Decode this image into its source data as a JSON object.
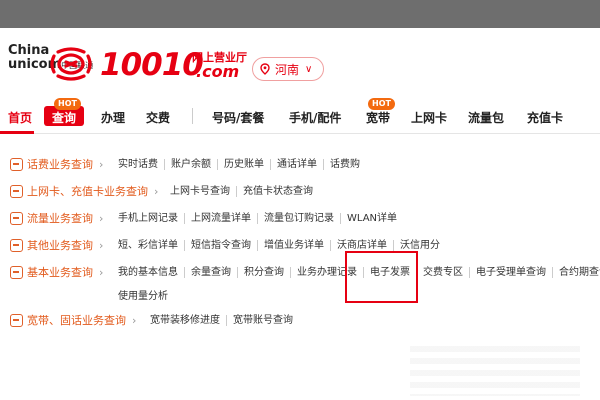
{
  "brand": {
    "company_line1": "China",
    "company_line2": "unicom",
    "company_cn": "中国联通",
    "number": "10010",
    "hall": "网上营业厅",
    "com": ".com",
    "province": "河南",
    "accent": "#e60012"
  },
  "nav": {
    "items": [
      {
        "label": "首页"
      },
      {
        "label": "查询",
        "badge": "HOT"
      },
      {
        "label": "办理"
      },
      {
        "label": "交费"
      },
      {
        "label": "号码/套餐"
      },
      {
        "label": "手机/配件"
      },
      {
        "label": "宽带",
        "badge": "HOT"
      },
      {
        "label": "上网卡"
      },
      {
        "label": "流量包"
      },
      {
        "label": "充值卡"
      }
    ]
  },
  "menu": {
    "rows": [
      {
        "category": "话费业务查询",
        "links": [
          "实时话费",
          "账户余额",
          "历史账单",
          "通话详单",
          "话费购"
        ]
      },
      {
        "category": "上网卡、充值卡业务查询",
        "links": [
          "上网卡号查询",
          "充值卡状态查询"
        ]
      },
      {
        "category": "流量业务查询",
        "links": [
          "手机上网记录",
          "上网流量详单",
          "流量包订购记录",
          "WLAN详单"
        ]
      },
      {
        "category": "其他业务查询",
        "links": [
          "短、彩信详单",
          "短信指令查询",
          "增值业务详单",
          "沃商店详单",
          "沃信用分"
        ]
      },
      {
        "category": "基本业务查询",
        "links": [
          "我的基本信息",
          "余量查询",
          "积分查询",
          "业务办理记录",
          "电子发票",
          "交费专区",
          "电子受理单查询",
          "合约期查询"
        ],
        "links_line2": [
          "使用量分析"
        ]
      },
      {
        "category": "宽带、固话业务查询",
        "links": [
          "宽带装移修进度",
          "宽带账号查询"
        ]
      }
    ]
  }
}
